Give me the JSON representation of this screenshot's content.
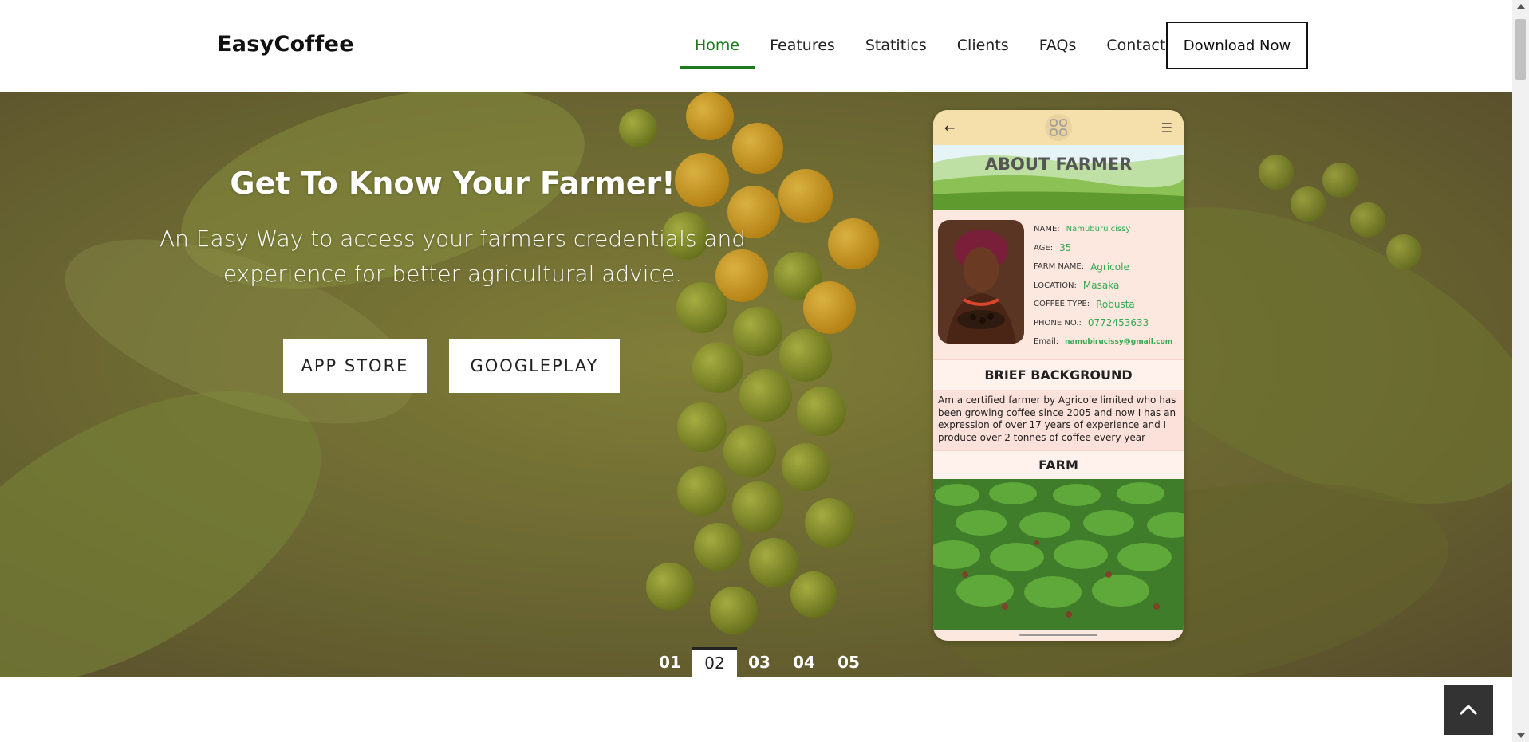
{
  "header": {
    "brand": "EasyCoffee",
    "nav": [
      {
        "label": "Home",
        "active": true
      },
      {
        "label": "Features"
      },
      {
        "label": "Statitics"
      },
      {
        "label": "Clients"
      },
      {
        "label": "FAQs"
      },
      {
        "label": "Contact"
      }
    ],
    "download_label": "Download Now",
    "accent_color": "#1e7a1e"
  },
  "hero": {
    "title": "Get To Know Your Farmer!",
    "subtitle": "An Easy Way to access your farmers credentials and experience for better agricultural advice.",
    "app_store_label": "APP STORE",
    "google_play_label": "GOOGLEPLAY"
  },
  "phone": {
    "back_icon": "arrow-left-icon",
    "grid_icon": "grid-icon",
    "menu_icon": "hamburger-menu-icon",
    "about_title": "ABOUT FARMER",
    "fields": [
      {
        "label": "NAME:",
        "value": "Namuburu cissy"
      },
      {
        "label": "AGE:",
        "value": "35"
      },
      {
        "label": "FARM NAME:",
        "value": "Agricole"
      },
      {
        "label": "LOCATION:",
        "value": "Masaka"
      },
      {
        "label": "COFFEE TYPE:",
        "value": "Robusta"
      },
      {
        "label": "PHONE NO.:",
        "value": "0772453633"
      },
      {
        "label": "Email:",
        "value": "namubirucissy@gmail.com"
      }
    ],
    "background_title": "BRIEF BACKGROUND",
    "background_text": "Am a certified farmer by Agricole limited who has been growing coffee since 2005 and now I has an expression of over 17 years of experience and I produce over 2 tonnes of coffee every year",
    "farm_title": "FARM"
  },
  "pager": {
    "pages": [
      "01",
      "02",
      "03",
      "04",
      "05"
    ],
    "active_index": 1
  },
  "back_to_top_icon": "chevron-up-icon"
}
